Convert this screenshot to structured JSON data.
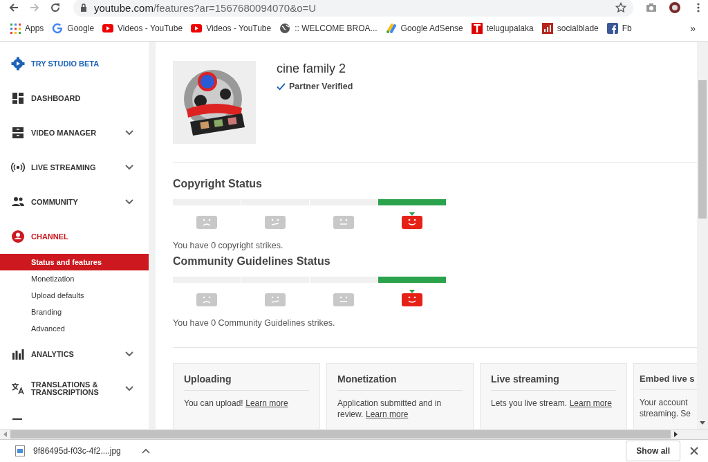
{
  "browser": {
    "url_host": "youtube.com",
    "url_path": "/features?ar=1567680094070&o=U",
    "bookmarks": [
      {
        "label": "Apps",
        "kind": "apps"
      },
      {
        "label": "Google",
        "kind": "google"
      },
      {
        "label": "Videos - YouTube",
        "kind": "youtube"
      },
      {
        "label": "Videos - YouTube",
        "kind": "youtube"
      },
      {
        "label": ":: WELCOME BROA...",
        "kind": "globe"
      },
      {
        "label": "Google AdSense",
        "kind": "adsense"
      },
      {
        "label": "telugupalaka",
        "kind": "t"
      },
      {
        "label": "socialblade",
        "kind": "bars"
      },
      {
        "label": "Fb",
        "kind": "fb"
      }
    ],
    "more": "»"
  },
  "sidebar": {
    "items": [
      {
        "label": "TRY STUDIO BETA",
        "kind": "gear",
        "expandable": false,
        "selected": false
      },
      {
        "label": "DASHBOARD",
        "kind": "dashboard",
        "expandable": false,
        "selected": false
      },
      {
        "label": "VIDEO MANAGER",
        "kind": "manager",
        "expandable": true,
        "selected": false
      },
      {
        "label": "LIVE STREAMING",
        "kind": "live",
        "expandable": true,
        "selected": false
      },
      {
        "label": "COMMUNITY",
        "kind": "people",
        "expandable": true,
        "selected": false
      },
      {
        "label": "CHANNEL",
        "kind": "person",
        "expandable": false,
        "selected": true,
        "children": [
          {
            "label": "Status and features",
            "selected": true
          },
          {
            "label": "Monetization",
            "selected": false
          },
          {
            "label": "Upload defaults",
            "selected": false
          },
          {
            "label": "Branding",
            "selected": false
          },
          {
            "label": "Advanced",
            "selected": false
          }
        ]
      },
      {
        "label": "ANALYTICS",
        "kind": "analytics",
        "expandable": true,
        "selected": false
      },
      {
        "label": "TRANSLATIONS & TRANSCRIPTIONS",
        "kind": "translate",
        "expandable": true,
        "selected": false
      }
    ]
  },
  "channel": {
    "name": "cine family 2",
    "verified": "Partner Verified"
  },
  "statuses": [
    {
      "title": "Copyright Status",
      "segments": [
        {
          "kind": "sad",
          "selected": false
        },
        {
          "kind": "unsure",
          "selected": false
        },
        {
          "kind": "neutral",
          "selected": false
        },
        {
          "kind": "happy",
          "selected": true
        }
      ],
      "message": "You have 0 copyright strikes."
    },
    {
      "title": "Community Guidelines Status",
      "segments": [
        {
          "kind": "sad",
          "selected": false
        },
        {
          "kind": "unsure",
          "selected": false
        },
        {
          "kind": "neutral",
          "selected": false
        },
        {
          "kind": "happy",
          "selected": true
        }
      ],
      "message": "You have 0 Community Guidelines strikes."
    }
  ],
  "features": [
    {
      "title": "Uploading",
      "body": "You can upload!",
      "link": "Learn more"
    },
    {
      "title": "Monetization",
      "body": "Application submitted and in review.",
      "link": "Learn more"
    },
    {
      "title": "Live streaming",
      "body": "Lets you live stream.",
      "link": "Learn more"
    },
    {
      "title": "Embed live s",
      "body": "Your account\nstreaming. Se"
    }
  ],
  "download": {
    "file": "9f86495d-f03c-4f2....jpg",
    "show_all": "Show all"
  }
}
